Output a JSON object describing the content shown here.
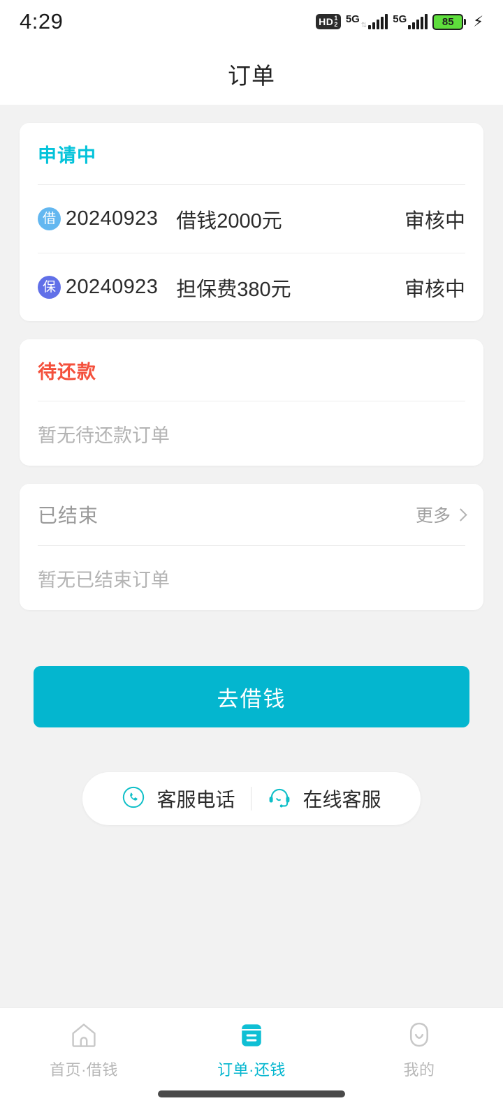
{
  "statusbar": {
    "time": "4:29",
    "hd_label": "HD",
    "hd_sup": "1",
    "hd_sub": "2",
    "network_1": "5G",
    "network_2": "5G",
    "battery_level": "85",
    "charging_icon": "⚡"
  },
  "header": {
    "title": "订单"
  },
  "cards": [
    {
      "title": "申请中",
      "title_color": "#04c3da",
      "rows": [
        {
          "badge": "借",
          "badge_color": "#63b7f0",
          "date": "20240923",
          "desc": "借钱2000元",
          "status": "审核中"
        },
        {
          "badge": "保",
          "badge_color": "#6170e8",
          "date": "20240923",
          "desc": "担保费380元",
          "status": "审核中"
        }
      ]
    },
    {
      "title": "待还款",
      "title_color": "#f4503c",
      "empty_text": "暂无待还款订单"
    },
    {
      "title": "已结束",
      "title_color": "#9a9a9a",
      "more_label": "更多",
      "empty_text": "暂无已结束订单"
    }
  ],
  "cta": {
    "label": "去借钱",
    "color": "#04b6cf"
  },
  "service": {
    "phone_label": "客服电话",
    "online_label": "在线客服",
    "icon_color": "#0fbfc8"
  },
  "bottom_nav": {
    "active_color": "#04b6cf",
    "inactive_color": "#b7b7b7",
    "items": [
      {
        "label": "首页·借钱",
        "icon": "home-icon"
      },
      {
        "label": "订单·还钱",
        "icon": "order-icon"
      },
      {
        "label": "我的",
        "icon": "profile-icon"
      }
    ]
  }
}
